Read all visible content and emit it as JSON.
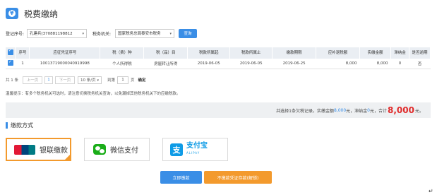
{
  "header": {
    "title": "税费缴纳"
  },
  "filter": {
    "reg_label": "登记序号:",
    "reg_value": "孔建兵[370881198812",
    "authority_label": "税务机关:",
    "authority_value": "国家税务总局泰安市税务",
    "query_label": "查询"
  },
  "table": {
    "headers": [
      "序号",
      "应征凭证序号",
      "税（费）种",
      "税（品）目",
      "税款所属起",
      "税款所属止",
      "缴款期限",
      "应补退税额",
      "实缴金额",
      "滞纳金",
      "是否逾期"
    ],
    "rows": [
      [
        "1",
        "10013719000040919998",
        "个人所得税",
        "房屋转让所得",
        "2019-06-05",
        "2019-06-05",
        "2019-06-25",
        "8,000",
        "8,000",
        "0",
        "否"
      ]
    ]
  },
  "pager": {
    "total": "共 1 条",
    "prev": "上一页",
    "current": "1",
    "next": "下一页",
    "page_size": "10 条/页",
    "goto_label": "到第",
    "goto_value": "1",
    "page_unit": "页",
    "confirm": "确定"
  },
  "tip": "温馨提示：有多个税务机关可选时，请注意切换税务机关查询，以免漏掉其他税务机关下的应缴税款。",
  "summary": {
    "prefix": "共选择1条欠税记录。实缴金额",
    "paid": "8,000",
    "mid": "元，滞纳金",
    "late": "0",
    "mid2": "元，合计",
    "total": "8,000",
    "suffix": "元。"
  },
  "payment": {
    "section_title": "缴款方式",
    "methods": [
      "银联缴款",
      "微信支付",
      "支付宝"
    ],
    "alipay_sub": "ALIPAY"
  },
  "actions": {
    "pay_now": "立即缴款",
    "voucher": "不缴款凭证存款(解锁)"
  },
  "colors": {
    "primary": "#3a8ee6",
    "accent": "#f39a2d",
    "total_red": "#e02b2b"
  }
}
